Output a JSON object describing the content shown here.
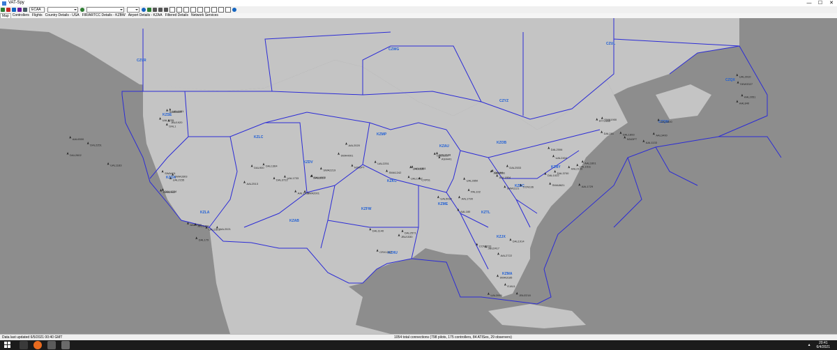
{
  "window": {
    "title": "VAT-Spy",
    "minimize_glyph": "—",
    "maximize_glyph": "☐",
    "close_glyph": "✕"
  },
  "toolbar": {
    "callsign_value": "ECAA",
    "icons": [
      "connect-icon",
      "disconnect-icon",
      "refresh-icon",
      "filter-icon",
      "settings-icon",
      "home-icon",
      "search-icon",
      "zoom-in-icon",
      "zoom-out-icon",
      "back-icon",
      "forward-icon",
      "labels-icon",
      "aircraft-icon",
      "airport-icon",
      "fir-icon",
      "range-icon",
      "trail-icon",
      "weather-icon",
      "grid-icon",
      "info-icon",
      "help-icon"
    ]
  },
  "tabs": [
    "Map",
    "Controllers",
    "Flights",
    "Country Details - USA",
    "FIR/ARTCC Details - KZBW",
    "Airport Details - KZAA",
    "Filtered Details",
    "Network Services"
  ],
  "map": {
    "colors": {
      "land": "#c4c4c4",
      "sea": "#8d8d8d",
      "boundary": "#2b2bd6",
      "label": "#1f5fd6",
      "aircraft": "#222222"
    },
    "region_labels": [
      "CZVR",
      "CZWG",
      "CZUL",
      "CZYZ",
      "CZQM",
      "CZQX",
      "KZSE",
      "KZLC",
      "KZDV",
      "KZMP",
      "KZAU",
      "KZOB",
      "KZNY",
      "KZDC",
      "KZKC",
      "KZME",
      "KZTL",
      "KZFW",
      "KZHU",
      "KZJX",
      "KZMA",
      "KZAB",
      "KZLA",
      "KZOA"
    ],
    "flight_labels": [
      "DAL1",
      "SWA401",
      "UAL2301",
      "AAL2513",
      "DAL2210",
      "N396PT",
      "UAL1351",
      "ASA441",
      "PAL102",
      "JBU3056",
      "DAL2533",
      "AAL1729",
      "UAL2404",
      "DAL1914",
      "EJA11",
      "JBU1530",
      "AAL840",
      "DAL2251",
      "SWA1900",
      "N343FT",
      "UAL1235",
      "SWA2442",
      "DAL179",
      "DAL1364",
      "DAL1573",
      "UAL2251",
      "SWA1242",
      "DAL2108",
      "UAL5032",
      "AAL1804",
      "DAL1022",
      "DAL3700",
      "AAL2190",
      "JBU2417",
      "SWA3185",
      "DAL2571",
      "AAL2051",
      "UAL1183",
      "DAL1893",
      "AAL3400",
      "UAL1981",
      "SWA3303",
      "JBU1900",
      "DAL3722",
      "AAL1205",
      "SWA4001",
      "UAL1757",
      "CXP61",
      "AAL180",
      "DAL94",
      "SWA1121",
      "UAL1511",
      "DAL2006",
      "AAL2722",
      "JBU2218",
      "CRX1240",
      "UAL2910",
      "AAL6500",
      "DAL281",
      "DAL1800",
      "SWA3500",
      "UAL2155",
      "AAL4750",
      "DAL900",
      "SWA2219",
      "AAL2020",
      "UAL1530",
      "DAL3310",
      "AAL1790",
      "UAL2850",
      "CCN136",
      "SWA8621",
      "AAL1601",
      "CCN2233",
      "UAL3901",
      "DAL1140",
      "SKW3327",
      "DAL2602",
      "FFT2450",
      "AAL1133",
      "JBU1920",
      "DAL1234",
      "AAL2021",
      "UAL1733",
      "SWA2001"
    ]
  },
  "status": {
    "left": "Data last updated 6/5/2021 00:40 GMT",
    "center": "1054 total connections (798 pilots, 175 controllers, 84 ATISes, 29 observers)"
  },
  "taskbar": {
    "time": "20:41",
    "date": "6/4/2021"
  }
}
